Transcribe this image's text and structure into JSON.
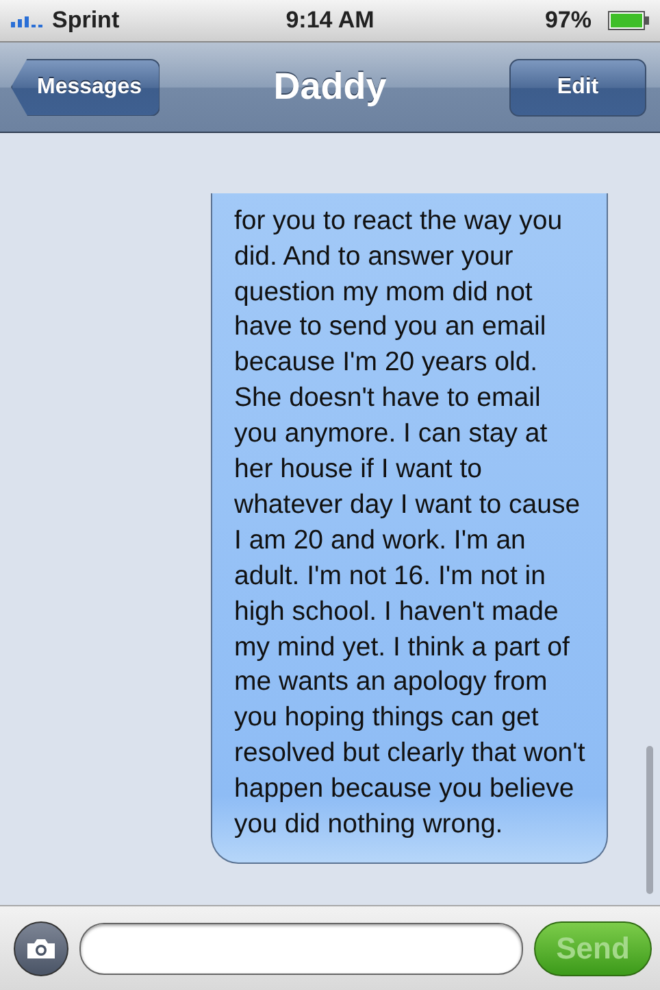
{
  "status_bar": {
    "carrier": "Sprint",
    "time": "9:14 AM",
    "battery": "97%"
  },
  "nav_bar": {
    "back_button": "Messages",
    "title": "Daddy",
    "edit_button": "Edit"
  },
  "messages": [
    {
      "kind": "sent",
      "text": "for you to react the way you did. And to answer your question my mom did not have to send you an email because I'm 20 years old. She doesn't have to email you anymore. I can stay at her house if I want to whatever day I want to cause I am 20 and work. I'm an adult. I'm not 16. I'm not in high school. I haven't made my mind yet. I think a part of me wants an apology from you hoping things can get resolved but clearly that won't happen because you believe you did nothing wrong."
    }
  ],
  "compose": {
    "send_button": "Send",
    "send_disabled": true
  }
}
